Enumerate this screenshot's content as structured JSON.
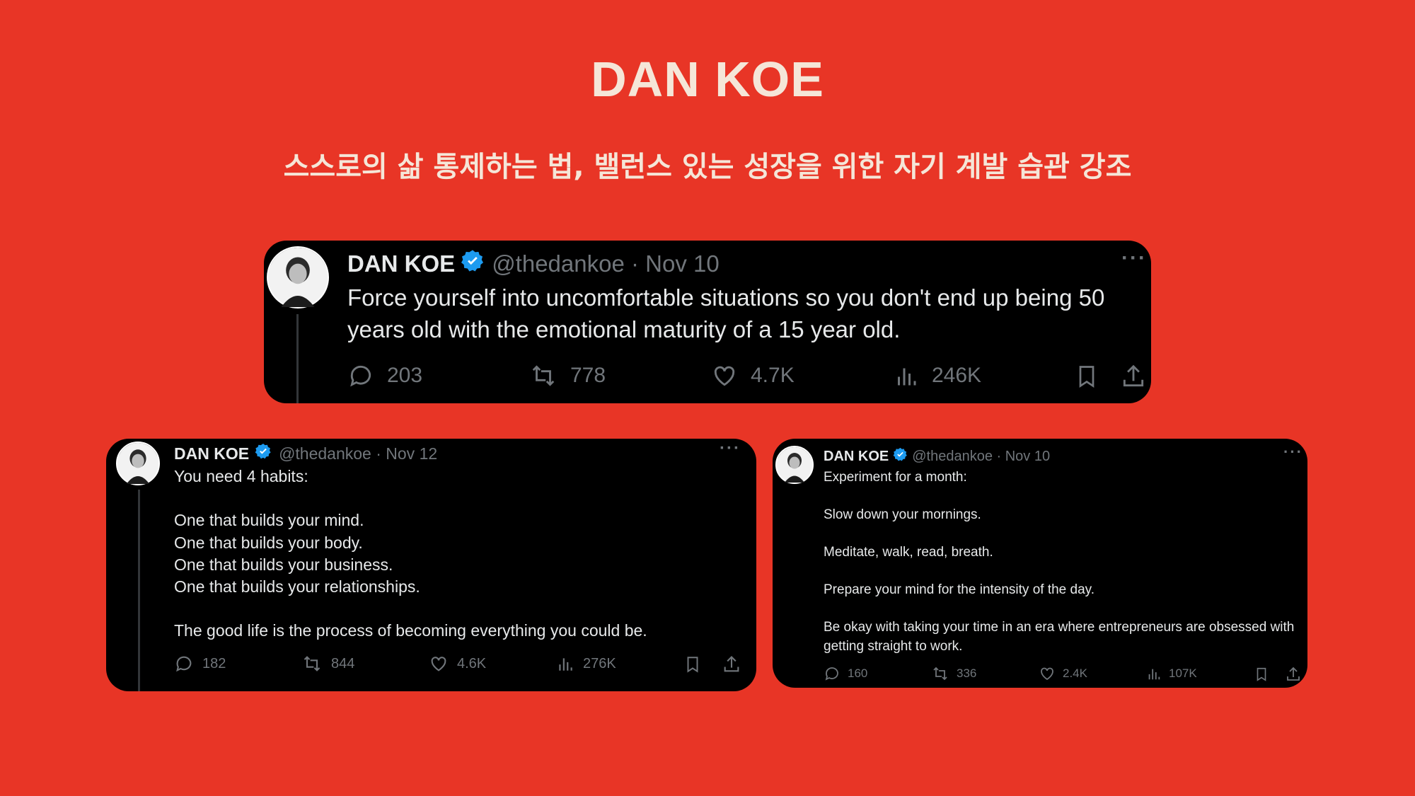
{
  "page": {
    "title": "DAN KOE",
    "subtitle": "스스로의 삶 통제하는 법, 밸런스 있는 성장을 위한 자기 계발 습관 강조",
    "background_color": "#E83526",
    "title_color": "#F5E6D8"
  },
  "tweets": [
    {
      "name": "DAN KOE",
      "handle": "@thedankoe · Nov 10",
      "text": "Force yourself into uncomfortable situations so you don't end up being 50 years old with the emotional maturity of a 15 year old.",
      "replies": "203",
      "retweets": "778",
      "likes": "4.7K",
      "views": "246K",
      "more": "···"
    },
    {
      "name": "DAN KOE",
      "handle": "@thedankoe · Nov 12",
      "text": "You need 4 habits:\n\nOne that builds your mind.\nOne that builds your body.\nOne that builds your business.\nOne that builds your relationships.\n\nThe good life is the process of becoming everything you could be.",
      "replies": "182",
      "retweets": "844",
      "likes": "4.6K",
      "views": "276K",
      "more": "···"
    },
    {
      "name": "DAN KOE",
      "handle": "@thedankoe · Nov 10",
      "text": "Experiment for a month:\n\nSlow down your mornings.\n\nMeditate, walk, read, breath.\n\nPrepare your mind for the intensity of the day.\n\nBe okay with taking your time in an era where entrepreneurs are obsessed with getting straight to work.",
      "replies": "160",
      "retweets": "336",
      "likes": "2.4K",
      "views": "107K",
      "more": "···"
    }
  ],
  "icons": {
    "verified": "verified-badge-icon",
    "reply": "reply-icon",
    "retweet": "retweet-icon",
    "like": "like-icon",
    "views": "views-icon",
    "bookmark": "bookmark-icon",
    "share": "share-icon",
    "accent": "#1D9BF0",
    "muted": "#71767B"
  }
}
